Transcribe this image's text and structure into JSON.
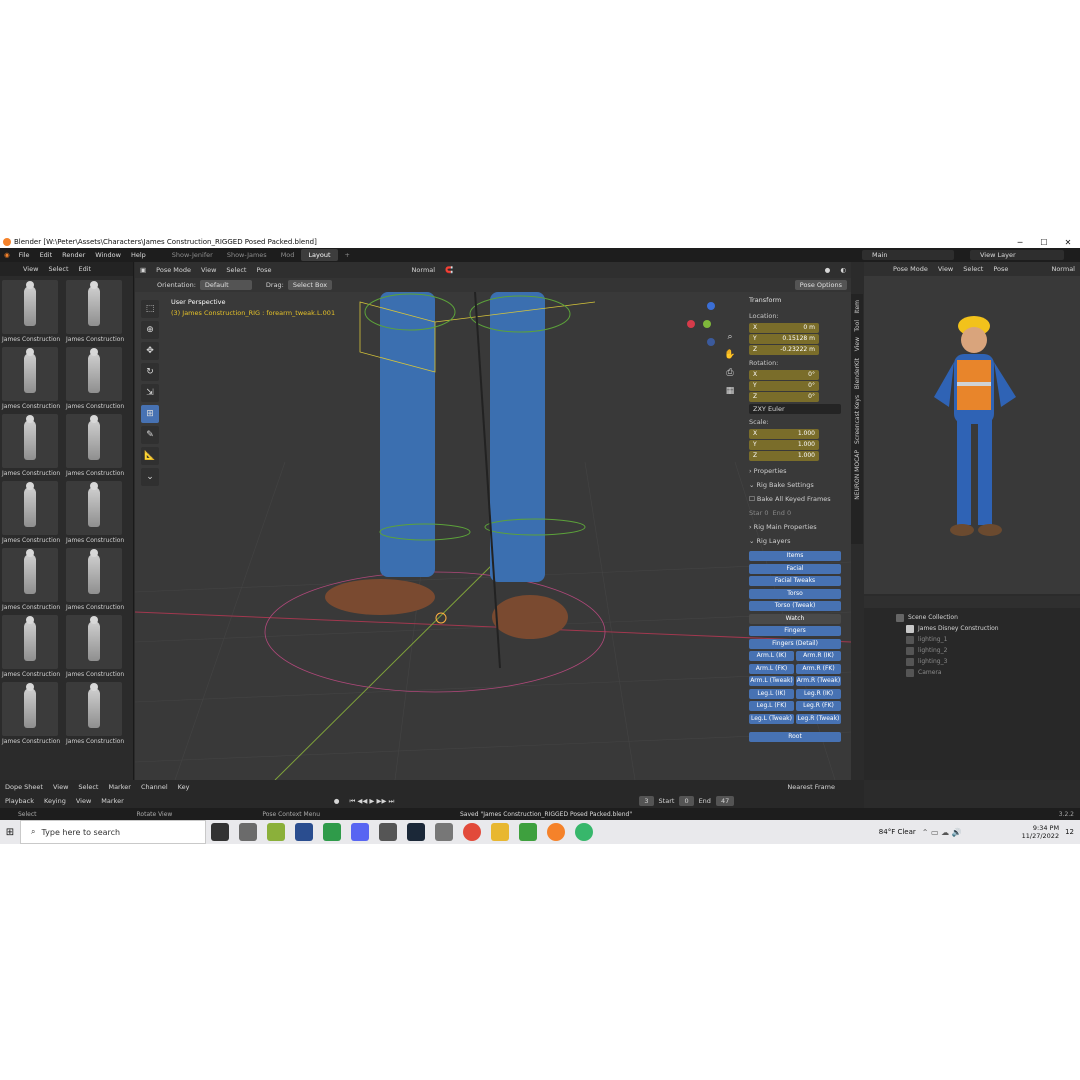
{
  "window": {
    "title": "Blender [W:\\Peter\\Assets\\Characters\\James Construction_RIGGED Posed Packed.blend]",
    "controls": [
      "─",
      "☐",
      "✕"
    ]
  },
  "menu": [
    "File",
    "Edit",
    "Render",
    "Window",
    "Help"
  ],
  "workspaces": [
    "Show-Jenifer",
    "Show-James",
    "Mod",
    "Layout"
  ],
  "workspace_add": "+",
  "scene": "Main",
  "view_layer": "View Layer",
  "asset_browser": {
    "menu": [
      "View",
      "Select",
      "Edit"
    ],
    "items": [
      "James Construction",
      "James Construction",
      "James Construction",
      "James Construction",
      "James Construction",
      "James Construction",
      "James Construction",
      "James Construction",
      "James Construction",
      "James Construction",
      "James Construction",
      "James Construction",
      "James Construction",
      "James Construction"
    ]
  },
  "viewport": {
    "mode": "Pose Mode",
    "menu": [
      "View",
      "Select",
      "Pose"
    ],
    "shading": "Normal",
    "orientation_label": "Orientation:",
    "orientation": "Default",
    "drag_label": "Drag:",
    "drag": "Select Box",
    "pose_options": "Pose Options",
    "perspective": "User Perspective",
    "active": "(3) James Construction_RIG : forearm_tweak.L.001"
  },
  "transform": {
    "title": "Transform",
    "location_label": "Location:",
    "location": [
      {
        "axis": "X",
        "value": "0 m"
      },
      {
        "axis": "Y",
        "value": "0.15128 m"
      },
      {
        "axis": "Z",
        "value": "-0.23222 m"
      }
    ],
    "rotation_label": "Rotation:",
    "rotation": [
      {
        "axis": "X",
        "value": "0°"
      },
      {
        "axis": "Y",
        "value": "0°"
      },
      {
        "axis": "Z",
        "value": "0°"
      }
    ],
    "rotation_mode": "ZXY Euler",
    "scale_label": "Scale:",
    "scale": [
      {
        "axis": "X",
        "value": "1.000"
      },
      {
        "axis": "Y",
        "value": "1.000"
      },
      {
        "axis": "Z",
        "value": "1.000"
      }
    ]
  },
  "sections": {
    "properties": "Properties",
    "rig_bake": "Rig Bake Settings",
    "bake_all": "Bake All Keyed Frames",
    "start": "Star  0",
    "end": "End  0",
    "rig_main": "Rig Main Properties",
    "rig_layers": "Rig Layers"
  },
  "rig_layers": {
    "single": [
      "Items",
      "Facial",
      "Facial Tweaks",
      "Torso",
      "Torso (Tweak)",
      "Watch",
      "Fingers",
      "Fingers (Detail)"
    ],
    "pairs": [
      [
        "Arm.L (IK)",
        "Arm.R (IK)"
      ],
      [
        "Arm.L (FK)",
        "Arm.R (FK)"
      ],
      [
        "Arm.L (Tweak)",
        "Arm.R (Tweak)"
      ],
      [
        "Leg.L (IK)",
        "Leg.R (IK)"
      ],
      [
        "Leg.L (FK)",
        "Leg.R (FK)"
      ],
      [
        "Leg.L (Tweak)",
        "Leg.R (Tweak)"
      ]
    ],
    "root": "Root"
  },
  "side_tabs": [
    "Item",
    "Tool",
    "View",
    "BlenderKit",
    "Screencast Keys",
    "NEURON MOCAP"
  ],
  "preview": {
    "mode": "Pose Mode",
    "menu": [
      "View",
      "Select",
      "Pose"
    ],
    "shading": "Normal"
  },
  "outliner": {
    "root": "Scene Collection",
    "items": [
      {
        "label": "James Disney Construction",
        "color": "#c9c9c9"
      },
      {
        "label": "lighting_1",
        "color": "#8a8a8a"
      },
      {
        "label": "lighting_2",
        "color": "#8a8a8a"
      },
      {
        "label": "lighting_3",
        "color": "#8a8a8a"
      },
      {
        "label": "Camera",
        "color": "#8a8a8a"
      }
    ]
  },
  "timeline": {
    "editor": "Dope Sheet",
    "menu1": [
      "View",
      "Select",
      "Marker",
      "Channel",
      "Key"
    ],
    "snap": "Nearest Frame",
    "menu2": [
      "Playback",
      "Keying",
      "View",
      "Marker"
    ],
    "current_frame": "3",
    "start_label": "Start",
    "start": "0",
    "end_label": "End",
    "end": "47"
  },
  "status": {
    "select": "Select",
    "rotate": "Rotate View",
    "context": "Pose Context Menu",
    "message": "Saved \"James Construction_RIGGED Posed Packed.blend\"",
    "version": "3.2.2"
  },
  "taskbar": {
    "search": "Type here to search",
    "weather": "84°F  Clear",
    "time": "9:34 PM",
    "date": "11/27/2022",
    "notif": "12"
  }
}
